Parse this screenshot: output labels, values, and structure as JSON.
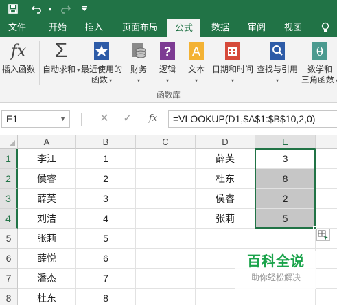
{
  "quick_access": {
    "save_icon": "save-icon",
    "undo_icon": "undo-icon",
    "redo_icon": "redo-icon",
    "customize_icon": "customize-qat-icon"
  },
  "tabs": [
    {
      "label": "文件"
    },
    {
      "label": "开始"
    },
    {
      "label": "插入"
    },
    {
      "label": "页面布局"
    },
    {
      "label": "公式"
    },
    {
      "label": "数据"
    },
    {
      "label": "审阅"
    },
    {
      "label": "视图"
    }
  ],
  "tell_me_icon": "lightbulb-icon",
  "ribbon": {
    "insert_function": "插入函数",
    "autosum": "自动求和",
    "recent_line1": "最近使用的",
    "recent_line2": "函数",
    "financial": "财务",
    "logical": "逻辑",
    "text": "文本",
    "datetime": "日期和时间",
    "lookup": "查找与引用",
    "math_line1": "数学和",
    "math_line2": "三角函数",
    "group_label": "函数库",
    "fx_glyph": "fx",
    "sigma_glyph": "Σ",
    "question_glyph": "?",
    "a_glyph": "A",
    "theta_glyph": "θ"
  },
  "formula_bar": {
    "name_box": "E1",
    "cancel_glyph": "✕",
    "enter_glyph": "✓",
    "fx_glyph": "fx",
    "formula": "=VLOOKUP(D1,$A$1:$B$10,2,0)"
  },
  "columns": [
    "A",
    "B",
    "C",
    "D",
    "E"
  ],
  "rows": [
    {
      "num": "1",
      "a": "李江",
      "b": "1",
      "d": "薛芙",
      "e": "3"
    },
    {
      "num": "2",
      "a": "侯睿",
      "b": "2",
      "d": "杜东",
      "e": "8"
    },
    {
      "num": "3",
      "a": "薛芙",
      "b": "3",
      "d": "侯睿",
      "e": "2"
    },
    {
      "num": "4",
      "a": "刘洁",
      "b": "4",
      "d": "张莉",
      "e": "5"
    },
    {
      "num": "5",
      "a": "张莉",
      "b": "5",
      "d": "",
      "e": ""
    },
    {
      "num": "6",
      "a": "薛悦",
      "b": "6",
      "d": "",
      "e": ""
    },
    {
      "num": "7",
      "a": "潘杰",
      "b": "7",
      "d": "",
      "e": ""
    },
    {
      "num": "8",
      "a": "杜东",
      "b": "8",
      "d": "",
      "e": ""
    }
  ],
  "watermark": {
    "title": "百科全说",
    "subtitle": "助你轻松解决"
  },
  "colors": {
    "accent": "#217346",
    "range_fill": "#c6c6c6",
    "watermark_green": "#1aa34a"
  }
}
